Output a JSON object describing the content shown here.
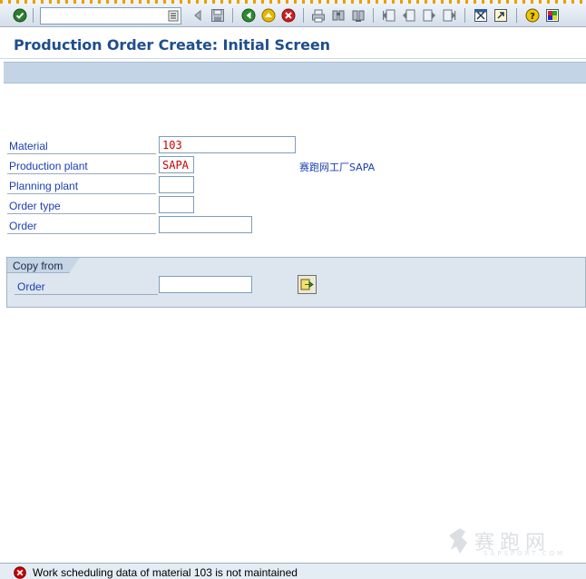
{
  "screen": {
    "title": "Production Order Create: Initial Screen"
  },
  "toolbar": {
    "command_field_value": "",
    "icons": [
      "enter-icon",
      "command-dropdown-icon",
      "back-arrow-icon",
      "save-icon",
      "back-icon",
      "exit-icon",
      "cancel-icon",
      "print-icon",
      "find-icon",
      "find-next-icon",
      "first-page-icon",
      "previous-page-icon",
      "next-page-icon",
      "last-page-icon",
      "create-session-icon",
      "shortcut-icon",
      "help-icon",
      "customize-layout-icon"
    ]
  },
  "form": {
    "material": {
      "label": "Material",
      "value": "103"
    },
    "production_plant": {
      "label": "Production plant",
      "value": "SAPA",
      "description": "赛跑网工厂SAPA"
    },
    "planning_plant": {
      "label": "Planning plant",
      "value": ""
    },
    "order_type": {
      "label": "Order type",
      "value": ""
    },
    "order": {
      "label": "Order",
      "value": ""
    }
  },
  "copy_from": {
    "title": "Copy from",
    "order_label": "Order",
    "order_value": "",
    "button_icon": "copy-arrow-icon"
  },
  "status_bar": {
    "type": "error",
    "message": "Work scheduling data of material 103 is not maintained"
  },
  "watermark": {
    "text": "赛跑网",
    "sub": "SAPSPORT.COM"
  },
  "colors": {
    "title": "#1f4e8c",
    "label": "#1b3fb0",
    "field_value": "#cc0000",
    "appbar": "#c3d4e6",
    "error": "#cc0000"
  }
}
